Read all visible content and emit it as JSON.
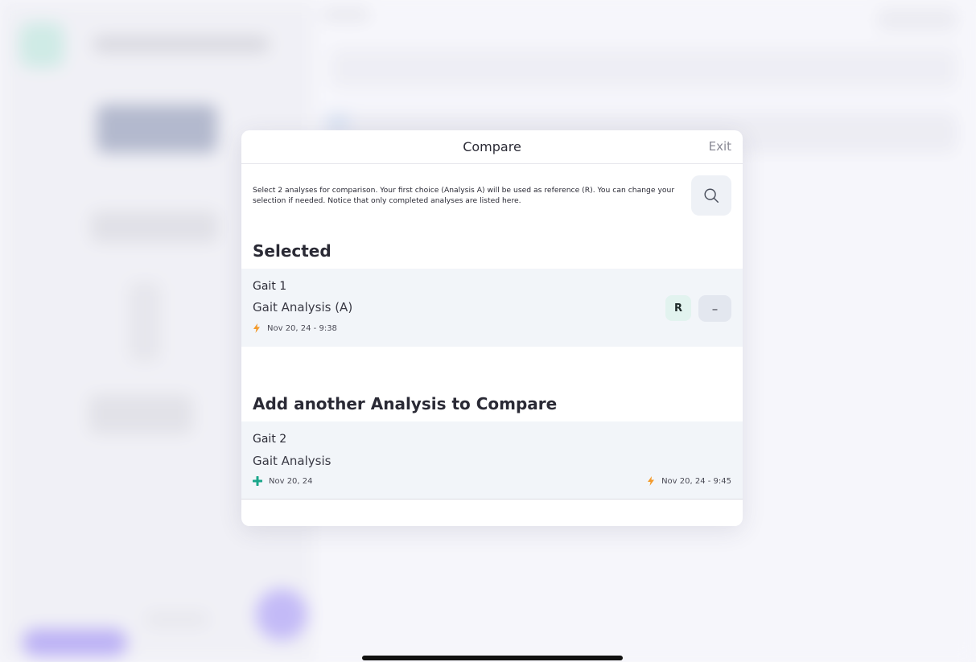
{
  "modal": {
    "title": "Compare",
    "exit_label": "Exit",
    "intro_text": "Select 2 analyses for comparison. Your first choice (Analysis A) will be used as reference (R). You can change your selection if needed. Notice that only completed analyses are listed here.",
    "search_icon": "search-icon"
  },
  "selected": {
    "section_title": "Selected",
    "items": [
      {
        "name": "Gait 1",
        "type": "Gait Analysis (A)",
        "date": "Nov 20, 24 - 9:38",
        "date_icon": "lightning-icon",
        "reference_badge": "R",
        "remove_label": "–"
      }
    ]
  },
  "add": {
    "section_title": "Add another Analysis to Compare",
    "items": [
      {
        "name": "Gait 2",
        "type": "Gait Analysis",
        "created": "Nov 20, 24",
        "created_icon": "plus-icon",
        "date": "Nov 20, 24 - 9:45",
        "date_icon": "lightning-icon"
      }
    ]
  },
  "colors": {
    "accent_green": "#1aa68a",
    "lightning_orange": "#f39a2b",
    "badge_bg": "#e2f3ef",
    "row_bg": "#f2f5f9"
  }
}
